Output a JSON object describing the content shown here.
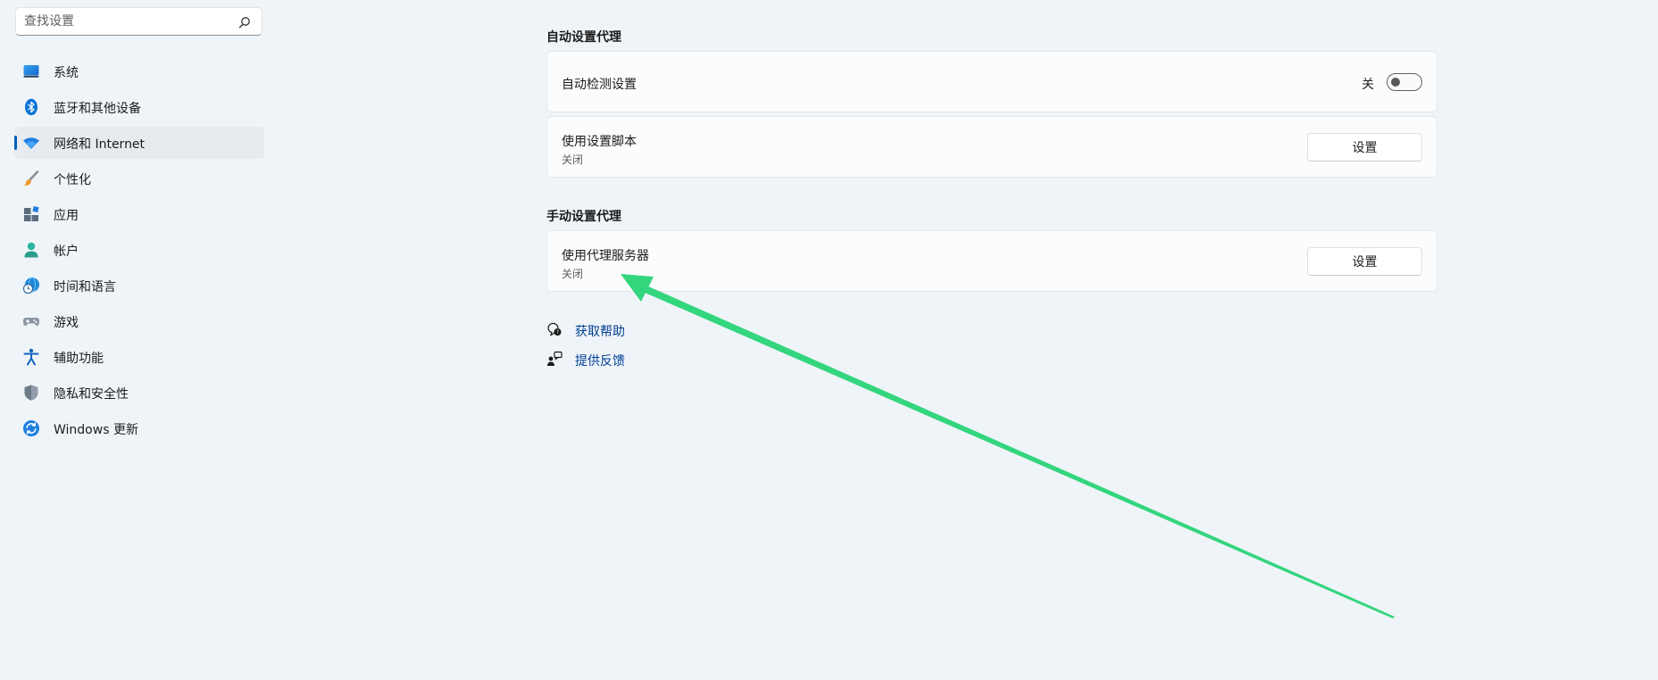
{
  "search": {
    "placeholder": "查找设置"
  },
  "sidebar": {
    "items": [
      {
        "label": "系统",
        "icon": "monitor-icon",
        "active": false
      },
      {
        "label": "蓝牙和其他设备",
        "icon": "bluetooth-icon",
        "active": false
      },
      {
        "label": "网络和 Internet",
        "icon": "wifi-icon",
        "active": true
      },
      {
        "label": "个性化",
        "icon": "brush-icon",
        "active": false
      },
      {
        "label": "应用",
        "icon": "apps-icon",
        "active": false
      },
      {
        "label": "帐户",
        "icon": "person-icon",
        "active": false
      },
      {
        "label": "时间和语言",
        "icon": "globe-clock-icon",
        "active": false
      },
      {
        "label": "游戏",
        "icon": "gamepad-icon",
        "active": false
      },
      {
        "label": "辅助功能",
        "icon": "accessibility-icon",
        "active": false
      },
      {
        "label": "隐私和安全性",
        "icon": "shield-icon",
        "active": false
      },
      {
        "label": "Windows 更新",
        "icon": "update-icon",
        "active": false
      }
    ]
  },
  "auto_proxy": {
    "title": "自动设置代理",
    "detect": {
      "label": "自动检测设置",
      "state": "关"
    },
    "script": {
      "label": "使用设置脚本",
      "status": "关闭",
      "button": "设置"
    }
  },
  "manual_proxy": {
    "title": "手动设置代理",
    "server": {
      "label": "使用代理服务器",
      "status": "关闭",
      "button": "设置"
    }
  },
  "links": {
    "help": "获取帮助",
    "feedback": "提供反馈"
  },
  "colors": {
    "accent": "#005fb8",
    "link": "#003e92",
    "arrow": "#2fd67a",
    "background": "#eff4f9"
  }
}
